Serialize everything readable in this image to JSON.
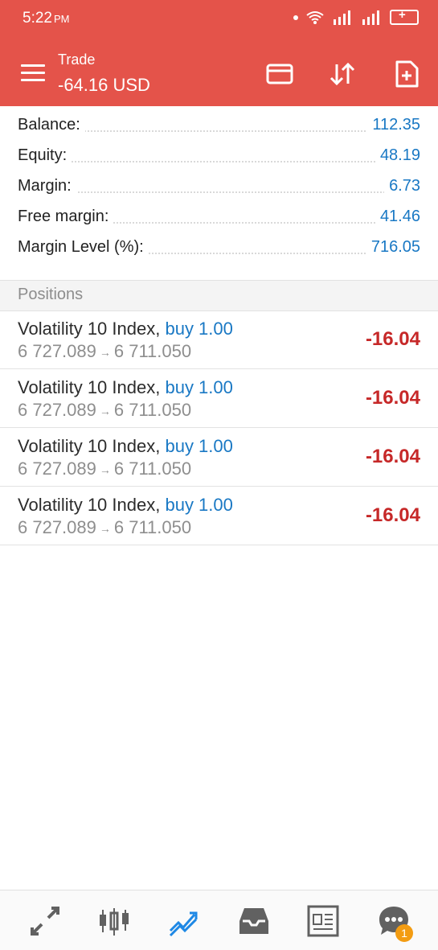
{
  "status": {
    "time": "5:22",
    "ampm": "PM"
  },
  "header": {
    "title": "Trade",
    "subtitle": "-64.16 USD"
  },
  "summary": [
    {
      "label": "Balance:",
      "value": "112.35"
    },
    {
      "label": "Equity:",
      "value": "48.19"
    },
    {
      "label": "Margin:",
      "value": "6.73"
    },
    {
      "label": "Free margin:",
      "value": "41.46"
    },
    {
      "label": "Margin Level (%):",
      "value": "716.05"
    }
  ],
  "positions_header": "Positions",
  "positions": [
    {
      "symbol": "Volatility 10 Index,",
      "side": "buy 1.00",
      "open": "6 727.089",
      "arrow": "→",
      "current": "6 711.050",
      "profit": "-16.04"
    },
    {
      "symbol": "Volatility 10 Index,",
      "side": "buy 1.00",
      "open": "6 727.089",
      "arrow": "→",
      "current": "6 711.050",
      "profit": "-16.04"
    },
    {
      "symbol": "Volatility 10 Index,",
      "side": "buy 1.00",
      "open": "6 727.089",
      "arrow": "→",
      "current": "6 711.050",
      "profit": "-16.04"
    },
    {
      "symbol": "Volatility 10 Index,",
      "side": "buy 1.00",
      "open": "6 727.089",
      "arrow": "→",
      "current": "6 711.050",
      "profit": "-16.04"
    }
  ],
  "tabbar": {
    "chat_badge": "1",
    "items": [
      "quotes-icon",
      "chart-icon",
      "trade-icon",
      "history-icon",
      "news-icon",
      "chat-icon"
    ]
  },
  "colors": {
    "header": "#e4534a",
    "value": "#1978c4",
    "loss": "#c62828",
    "active_tab": "#1e88e5"
  }
}
